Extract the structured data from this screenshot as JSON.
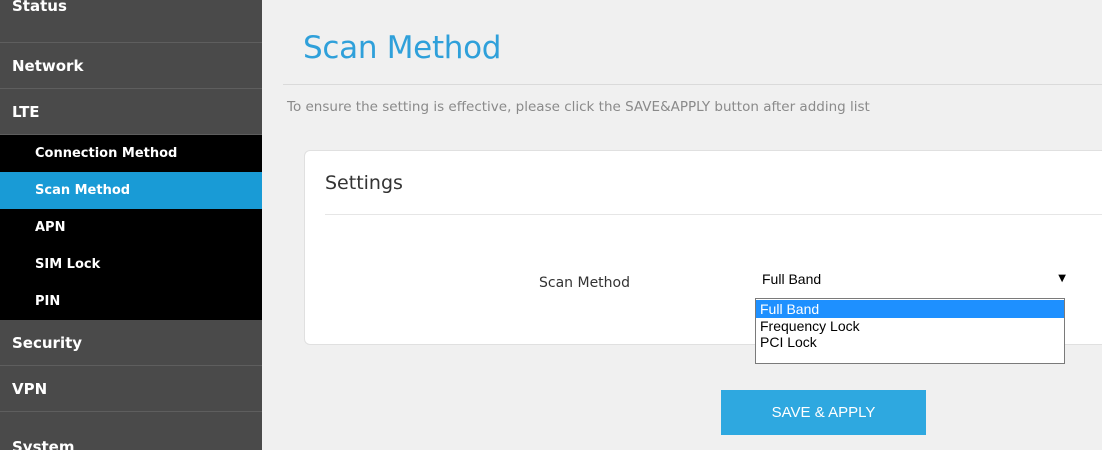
{
  "sidebar": {
    "status": "Status",
    "network": "Network",
    "lte": "LTE",
    "lte_items": [
      "Connection Method",
      "Scan Method",
      "APN",
      "SIM Lock",
      "PIN"
    ],
    "security": "Security",
    "vpn": "VPN",
    "system": "System",
    "active_item": "Scan Method"
  },
  "main": {
    "title": "Scan Method",
    "hint": "To ensure the setting is effective, please click the SAVE&APPLY button after adding list",
    "card_title": "Settings",
    "field_label": "Scan Method",
    "select_value": "Full Band",
    "options": [
      "Full Band",
      "Frequency Lock",
      "PCI Lock"
    ],
    "save_label": "SAVE & APPLY"
  },
  "colors": {
    "accent": "#2fa0da",
    "sidebar_bg": "#4a4a4a",
    "active_bg": "#199bd6",
    "button_bg": "#2ea8e0"
  }
}
